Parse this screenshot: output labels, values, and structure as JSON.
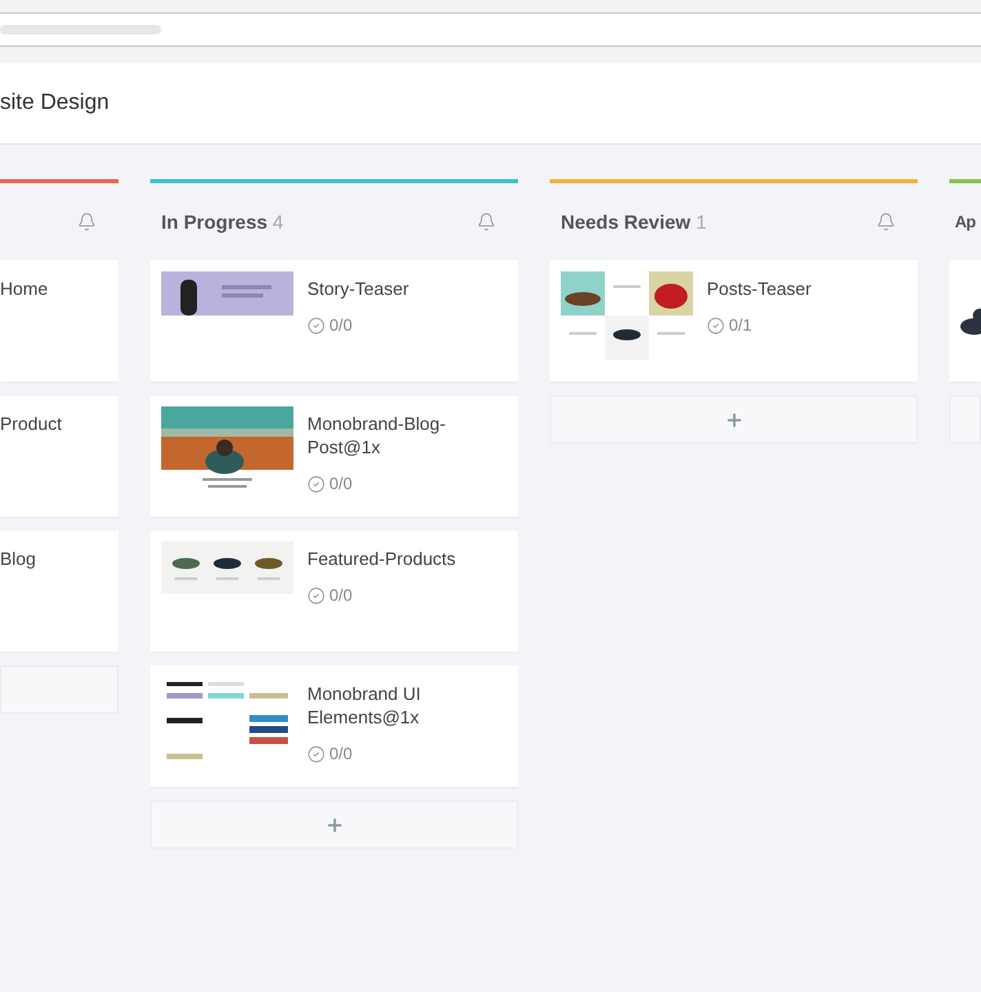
{
  "board": {
    "title": "site Design",
    "columns": [
      {
        "kind": "cut-left",
        "color": "#ea6552",
        "cards": [
          {
            "title": "Home"
          },
          {
            "title": "Product"
          },
          {
            "title": "Blog"
          }
        ]
      },
      {
        "kind": "full",
        "name": "In Progress",
        "count": "4",
        "color": "#3fc0d4",
        "cards": [
          {
            "title": "Story-Teaser",
            "checks": "0/0"
          },
          {
            "title": "Monobrand-Blog-Post@1x",
            "checks": "0/0"
          },
          {
            "title": "Featured-Products",
            "checks": "0/0"
          },
          {
            "title": "Monobrand UI Elements@1x",
            "checks": "0/0"
          }
        ]
      },
      {
        "kind": "full",
        "name": "Needs Review",
        "count": "1",
        "color": "#f0b43c",
        "cards": [
          {
            "title": "Posts-Teaser",
            "checks": "0/1"
          }
        ]
      },
      {
        "kind": "cut-right",
        "name": "Ap",
        "color": "#8bc34a"
      }
    ]
  }
}
